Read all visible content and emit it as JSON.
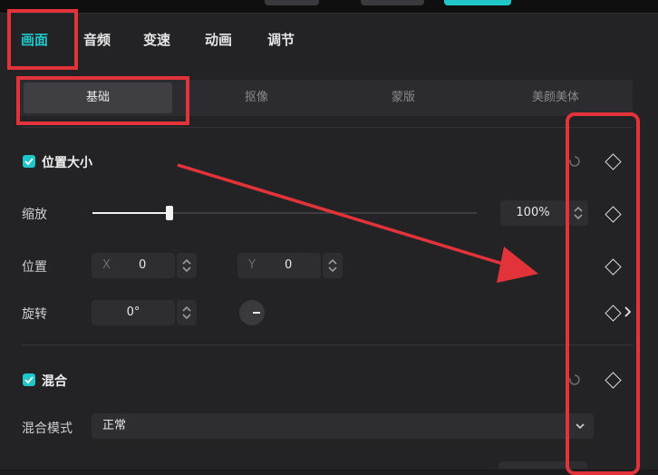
{
  "tabs": [
    "画面",
    "音频",
    "变速",
    "动画",
    "调节"
  ],
  "active_tab_index": 0,
  "subtabs": [
    "基础",
    "抠像",
    "蒙版",
    "美颜美体"
  ],
  "active_subtab_index": 0,
  "section_position": {
    "title": "位置大小",
    "checked": true,
    "scale_label": "缩放",
    "scale_value": "100%",
    "scale_fraction": 0.2,
    "position_label": "位置",
    "x_prefix": "X",
    "x_value": "0",
    "y_prefix": "Y",
    "y_value": "0",
    "rotate_label": "旋转",
    "rotate_value": "0°"
  },
  "section_blend": {
    "title": "混合",
    "checked": true,
    "mode_label": "混合模式",
    "mode_value": "正常"
  },
  "colors": {
    "accent": "#1fc7c9",
    "annotation_red": "#e3333a"
  }
}
